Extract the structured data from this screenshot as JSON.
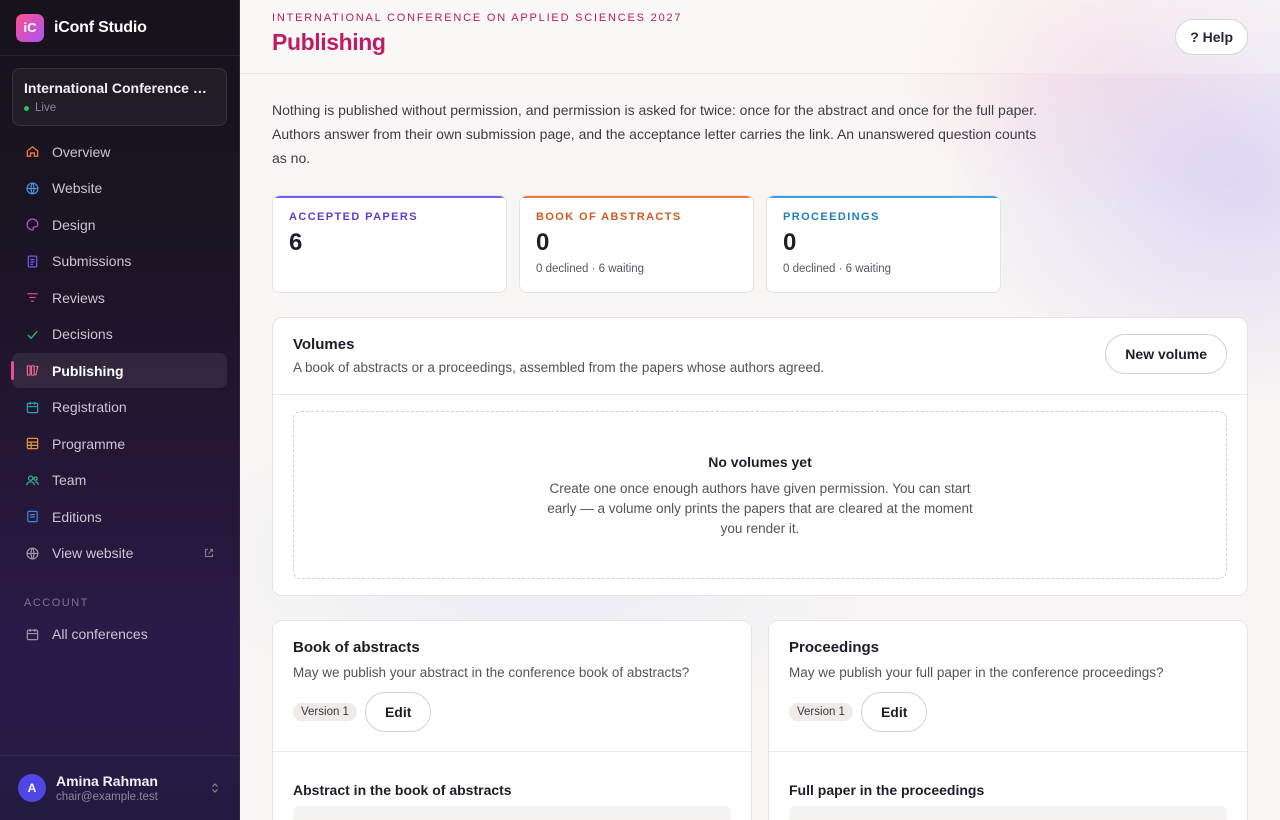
{
  "brand": {
    "logo": "iC",
    "name": "iConf Studio"
  },
  "conference": {
    "name": "International Conference on Applied Sciences 2027",
    "status": "Live"
  },
  "nav": [
    {
      "label": "Overview",
      "icon": "home-icon",
      "color": "#f07a3a"
    },
    {
      "label": "Website",
      "icon": "globe-icon",
      "color": "#4a90e2"
    },
    {
      "label": "Design",
      "icon": "palette-icon",
      "color": "#c34bd8"
    },
    {
      "label": "Submissions",
      "icon": "document-icon",
      "color": "#6a5cf0"
    },
    {
      "label": "Reviews",
      "icon": "filter-icon",
      "color": "#e0457b"
    },
    {
      "label": "Decisions",
      "icon": "check-icon",
      "color": "#2fb374"
    },
    {
      "label": "Publishing",
      "icon": "books-icon",
      "color": "#f06292"
    },
    {
      "label": "Registration",
      "icon": "calendar-icon",
      "color": "#2aa3b8"
    },
    {
      "label": "Programme",
      "icon": "grid-icon",
      "color": "#e09a2a"
    },
    {
      "label": "Team",
      "icon": "users-icon",
      "color": "#2fb38f"
    },
    {
      "label": "Editions",
      "icon": "file-icon",
      "color": "#3a8ad8"
    },
    {
      "label": "View website",
      "icon": "globe-icon",
      "color": "#9a96a6"
    }
  ],
  "account_label": "ACCOUNT",
  "account_nav": [
    {
      "label": "All conferences",
      "icon": "calendar-icon"
    }
  ],
  "user": {
    "initial": "A",
    "name": "Amina Rahman",
    "email": "chair@example.test"
  },
  "header": {
    "eyebrow": "INTERNATIONAL CONFERENCE ON APPLIED SCIENCES 2027",
    "title": "Publishing",
    "help_label": "? Help"
  },
  "intro": "Nothing is published without permission, and permission is asked for twice: once for the abstract and once for the full paper. Authors answer from their own submission page, and the acceptance letter carries the link. An unanswered question counts as no.",
  "stats": [
    {
      "label": "ACCEPTED PAPERS",
      "value": "6",
      "sub": ""
    },
    {
      "label": "BOOK OF ABSTRACTS",
      "value": "0",
      "sub": "0 declined · 6 waiting"
    },
    {
      "label": "PROCEEDINGS",
      "value": "0",
      "sub": "0 declined · 6 waiting"
    }
  ],
  "volumes": {
    "title": "Volumes",
    "description": "A book of abstracts or a proceedings, assembled from the papers whose authors agreed.",
    "new_label": "New volume",
    "empty_title": "No volumes yet",
    "empty_text": "Create one once enough authors have given permission. You can start early — a volume only prints the papers that are cleared at the moment you render it."
  },
  "abstracts_card": {
    "title": "Book of abstracts",
    "question": "May we publish your abstract in the conference book of abstracts?",
    "version": "Version 1",
    "edit_label": "Edit",
    "sub_title": "Abstract in the book of abstracts"
  },
  "proceedings_card": {
    "title": "Proceedings",
    "question": "May we publish your full paper in the conference proceedings?",
    "version": "Version 1",
    "edit_label": "Edit",
    "sub_title": "Full paper in the proceedings"
  }
}
